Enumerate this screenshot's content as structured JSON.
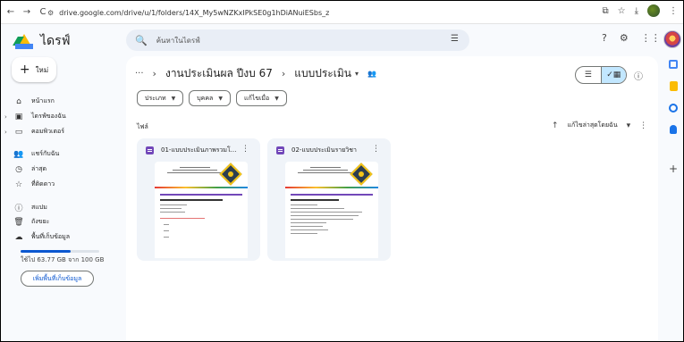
{
  "browser": {
    "url": "drive.google.com/drive/u/1/folders/14X_My5wNZKxIPkSE0g1hDiANuiESbs_z",
    "nav": [
      "←",
      "→",
      "C"
    ]
  },
  "app": {
    "name": "ไดรฟ์",
    "search_placeholder": "ค้นหาในไดรฟ์"
  },
  "sidebar": {
    "new_label": "ใหม่",
    "items": [
      {
        "label": "หน้าแรก",
        "icon": "⌂",
        "caret": ""
      },
      {
        "label": "ไดรฟ์ของฉัน",
        "icon": "▣",
        "caret": "›"
      },
      {
        "label": "คอมพิวเตอร์",
        "icon": "▭",
        "caret": "›"
      },
      {
        "label": "แชร์กับฉัน",
        "icon": "👥",
        "caret": ""
      },
      {
        "label": "ล่าสุด",
        "icon": "◷",
        "caret": ""
      },
      {
        "label": "ที่ติดดาว",
        "icon": "☆",
        "caret": ""
      },
      {
        "label": "สแปม",
        "icon": "ⓘ",
        "caret": ""
      },
      {
        "label": "ถังขยะ",
        "icon": "🗑",
        "caret": ""
      },
      {
        "label": "พื้นที่เก็บข้อมูล",
        "icon": "☁",
        "caret": ""
      }
    ],
    "storage_text": "ใช้ไป 63.77 GB จาก 100 GB",
    "storage_fraction": 0.64,
    "get_more_label": "เพิ่มพื้นที่เก็บข้อมูล"
  },
  "breadcrumb": {
    "more": "···",
    "parent": "งานประเมินผล ปีงบ 67",
    "current": "แบบประเมิน"
  },
  "filters": [
    {
      "label": "ประเภท"
    },
    {
      "label": "บุคคล"
    },
    {
      "label": "แก้ไขเมื่อ"
    }
  ],
  "files_label": "ไฟล์",
  "sort_label": "แก้ไขล่าสุดโดยฉัน",
  "files": [
    {
      "title": "01-แบบประเมินภาพรวมโ..."
    },
    {
      "title": "02-แบบประเมินรายวิชา"
    }
  ],
  "colors": {
    "accent": "#0b57d0",
    "forms_purple": "#7248b9",
    "selected_toggle": "#c2e7ff"
  }
}
